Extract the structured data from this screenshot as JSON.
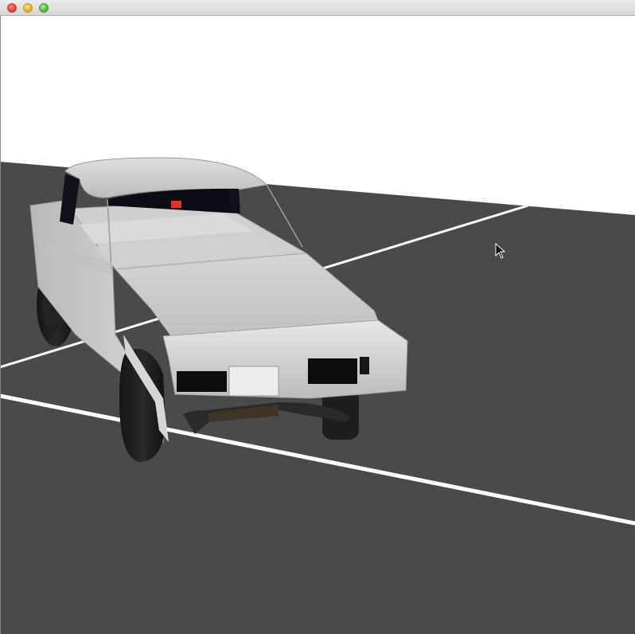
{
  "window": {
    "title": "",
    "buttons": [
      "close",
      "minimize",
      "zoom"
    ]
  },
  "scene": {
    "sky_color": "#ffffff",
    "ground_color": "#4a4a4a",
    "line_color": "#ffffff",
    "car_body_color": "#c8c8c8",
    "taillight_color": "#e0332a",
    "cursor_icon": "arrow-cursor-icon"
  }
}
